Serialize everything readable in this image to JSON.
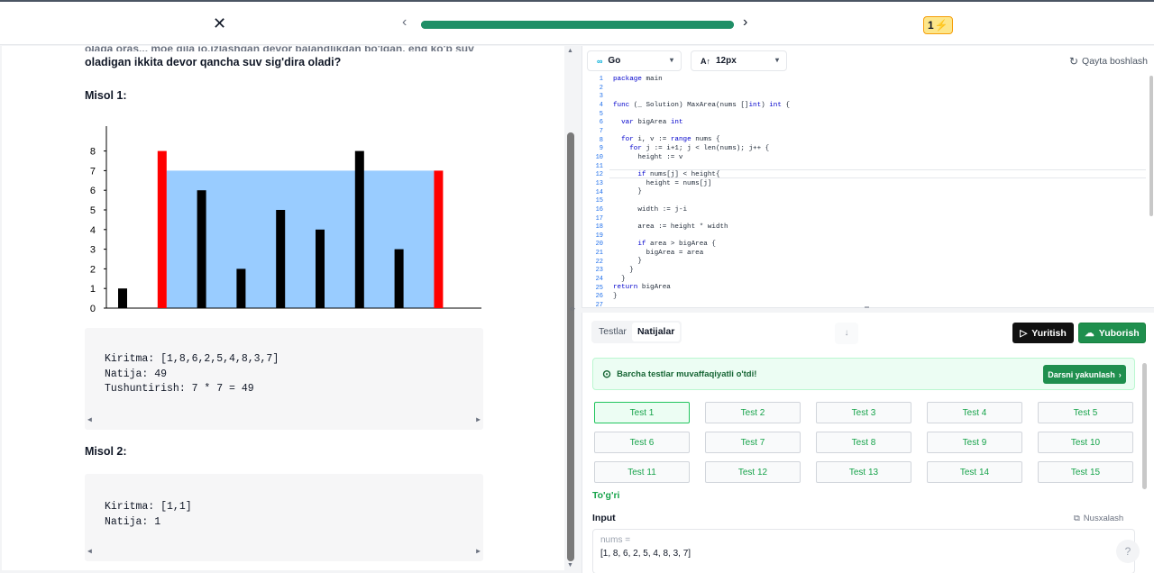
{
  "topbar": {
    "close_icon": "close-icon",
    "prev_icon": "chevron-left-icon",
    "next_icon": "chevron-right-icon",
    "progress_fraction": 1.0,
    "streak_count": "1",
    "streak_icon": "lightning-icon"
  },
  "problem": {
    "cut_line": "olaga oras... moe qila jo,izlashgan devor balandlikdan bo'lgan, eng ko'p suv sig'dira",
    "para": "oladigan ikkita devor qancha suv sig'dira oladi?",
    "misol1_title": "Misol 1:",
    "misol1_lines": [
      "Kiritma: [1,8,6,2,5,4,8,3,7]",
      "Natija: 49",
      "Tushuntirish: 7 * 7 = 49"
    ],
    "misol2_title": "Misol 2:",
    "misol2_lines": [
      "Kiritma: [1,1]",
      "Natija: 1"
    ]
  },
  "chart_data": {
    "type": "bar",
    "values": [
      1,
      8,
      6,
      2,
      5,
      4,
      8,
      3,
      7
    ],
    "highlight_indices": [
      1,
      8
    ],
    "water_level": 7,
    "water_from_index": 1,
    "water_to_index": 8,
    "yticks": [
      0,
      1,
      2,
      3,
      4,
      5,
      6,
      7,
      8
    ],
    "ylim": [
      0,
      8
    ],
    "colors": {
      "bar": "#000000",
      "highlight": "#ff0000",
      "water": "#99ccff"
    }
  },
  "editor": {
    "language": "Go",
    "language_icon": "go-logo-icon",
    "font_size": "12px",
    "font_icon": "font-size-icon",
    "restart_label": "Qayta boshlash",
    "restart_icon": "restart-icon",
    "code": [
      "package main",
      "",
      "",
      "func (_ Solution) MaxArea(nums []int) int {",
      "",
      "  var bigArea int",
      "",
      "  for i, v := range nums {",
      "    for j := i+1; j < len(nums); j++ {",
      "      height := v",
      "",
      "      if nums[j] < height{",
      "        height = nums[j]",
      "      }",
      "",
      "      width := j-i",
      "",
      "      area := height * width",
      "",
      "      if area > bigArea {",
      "        bigArea = area",
      "      }",
      "    }",
      "  }",
      "return bigArea",
      "}",
      ""
    ]
  },
  "results": {
    "tab_tests": "Testlar",
    "tab_results": "Natijalar",
    "run_label": "Yuritish",
    "submit_label": "Yuborish",
    "success_text": "Barcha testlar muvaffaqiyatli o'tdi!",
    "finish_label": "Darsni yakunlash",
    "tests": [
      "Test 1",
      "Test 2",
      "Test 3",
      "Test 4",
      "Test 5",
      "Test 6",
      "Test 7",
      "Test 8",
      "Test 9",
      "Test 10",
      "Test 11",
      "Test 12",
      "Test 13",
      "Test 14",
      "Test 15"
    ],
    "active_test": 0,
    "verdict": "To'g'ri",
    "input_label": "Input",
    "copy_label": "Nusxalash",
    "input_var": "nums =",
    "input_value": "[1, 8, 6, 2, 5, 4, 8, 3, 7]",
    "help": "?"
  }
}
